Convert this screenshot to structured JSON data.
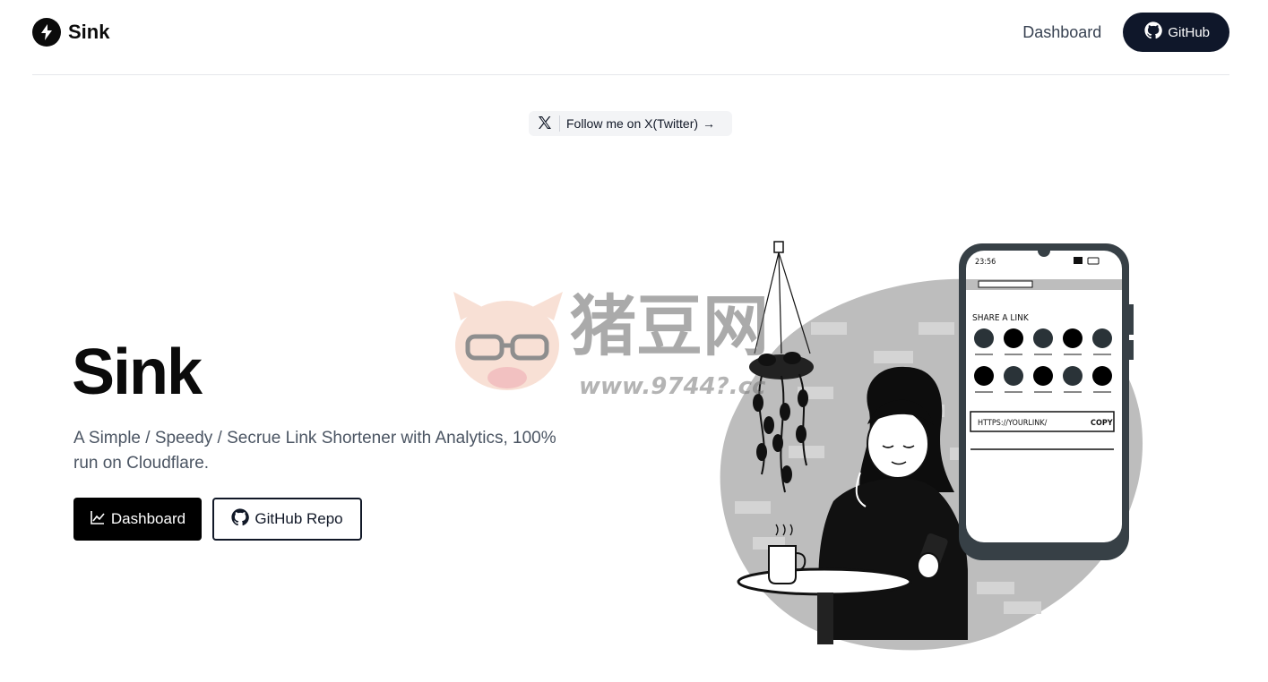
{
  "header": {
    "brand_name": "Sink",
    "nav_dashboard": "Dashboard",
    "github_label": "GitHub"
  },
  "follow": {
    "label": "Follow me on X(Twitter)",
    "arrow": "→"
  },
  "hero": {
    "title": "Sink",
    "description": "A Simple / Speedy / Secrue Link Shortener with Analytics, 100% run on Cloudflare.",
    "dashboard_button": "Dashboard",
    "repo_button": "GitHub Repo"
  },
  "illustration": {
    "phone_time": "23:56",
    "share_title": "SHARE A LINK",
    "link_placeholder": "HTTPS://YOURLINK/",
    "copy_label": "COPY"
  },
  "watermark": {
    "text": "猪豆网",
    "url": "www.9744?.cc"
  },
  "colors": {
    "primary": "#0f172a",
    "black": "#000000",
    "blob": "#bdbdbd",
    "phone_dark": "#374046"
  },
  "icons": {
    "brand": "lightning-icon",
    "github": "github-icon",
    "x": "x-logo-icon",
    "chart": "chart-line-icon"
  }
}
